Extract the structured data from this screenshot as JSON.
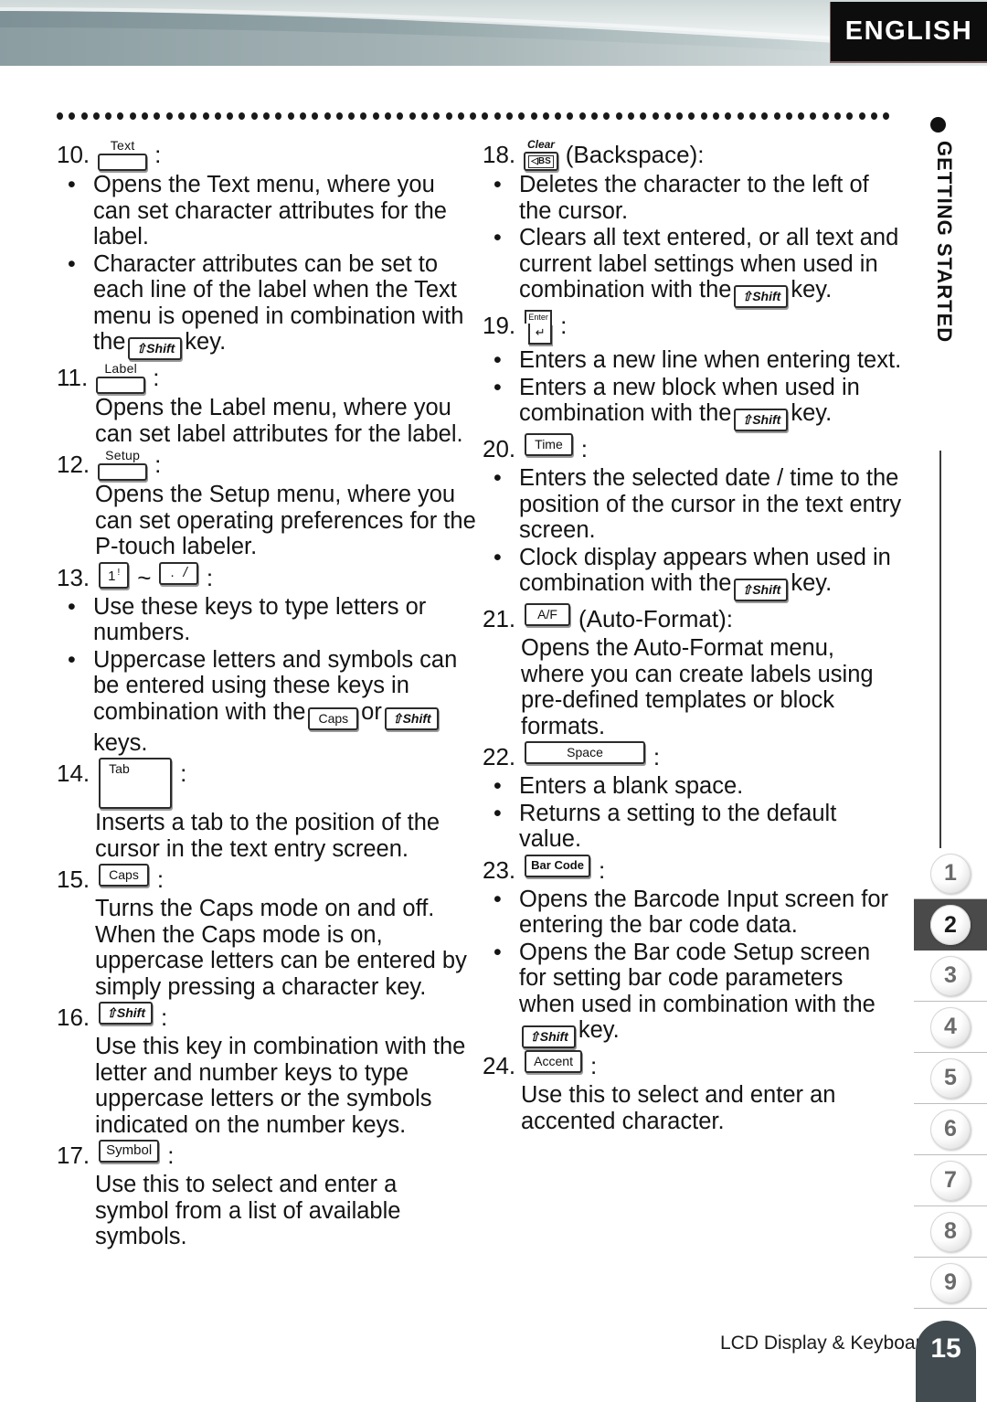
{
  "header": {
    "language_badge": "ENGLISH"
  },
  "side_rail": {
    "section_title": "GETTING STARTED",
    "tabs": [
      "1",
      "2",
      "3",
      "4",
      "5",
      "6",
      "7",
      "8",
      "9"
    ],
    "active_tab": "2"
  },
  "footer": {
    "caption": "LCD Display & Keyboard",
    "page_number": "15"
  },
  "keys": {
    "text": "Text",
    "label": "Label",
    "setup": "Setup",
    "shift": "⇧Shift",
    "caps": "Caps",
    "tab": "Tab",
    "symbol": "Symbol",
    "clear": "Clear",
    "bs": "BS",
    "enter_top": "Enter",
    "enter_arrow": "↵",
    "time": "Time",
    "af": "A/F",
    "space": "Space",
    "barcode": "Bar Code",
    "accent": "Accent",
    "num_one": "1",
    "num_one_sup": "!",
    "dot": ".",
    "slash": "/",
    "tilde": "~"
  },
  "left_column": [
    {
      "num": "10.",
      "key_type": "stack",
      "key_label": "Text",
      "suffix": "",
      "bullets": [
        "Opens the Text menu, where you can set character attributes for the label.",
        "Character attributes can be set to each line of the label when the Text menu is opened in combination with the ⇧Shift key."
      ],
      "paragraph": ""
    },
    {
      "num": "11.",
      "key_type": "stack",
      "key_label": "Label",
      "suffix": "",
      "bullets": [],
      "paragraph": "Opens the Label menu, where you can set label attributes for the label."
    },
    {
      "num": "12.",
      "key_type": "stack",
      "key_label": "Setup",
      "suffix": "",
      "bullets": [],
      "paragraph": "Opens the Setup menu, where you can set operating preferences for the P-touch labeler."
    },
    {
      "num": "13.",
      "key_type": "range",
      "key_label": "1 ! ~ . /",
      "suffix": "",
      "bullets": [
        "Use these keys to type letters or numbers.",
        "Uppercase letters and symbols can be entered using these keys in combination with the Caps or ⇧Shift keys."
      ],
      "paragraph": ""
    },
    {
      "num": "14.",
      "key_type": "cap",
      "key_label": "Tab",
      "suffix": "",
      "bullets": [],
      "paragraph": "Inserts a tab to the position of the cursor in the text entry screen."
    },
    {
      "num": "15.",
      "key_type": "cap",
      "key_label": "Caps",
      "suffix": "",
      "bullets": [],
      "paragraph": "Turns the Caps mode on and off. When the Caps mode is on, uppercase letters can be entered by simply pressing a character key."
    },
    {
      "num": "16.",
      "key_type": "cap",
      "key_label": "⇧Shift",
      "suffix": "",
      "bullets": [],
      "paragraph": "Use this key in combination with the letter and number keys to type uppercase letters or the symbols indicated on the number keys."
    },
    {
      "num": "17.",
      "key_type": "cap",
      "key_label": "Symbol",
      "suffix": "",
      "bullets": [],
      "paragraph": "Use this to select and enter a symbol from a list of available symbols."
    }
  ],
  "right_column": [
    {
      "num": "18.",
      "key_type": "clear",
      "key_label": "Clear BS",
      "suffix": "(Backspace)",
      "bullets": [
        "Deletes the character to the left of the cursor.",
        "Clears all text entered, or all text and current label settings when used in combination with the ⇧Shift key."
      ],
      "paragraph": ""
    },
    {
      "num": "19.",
      "key_type": "enter",
      "key_label": "Enter",
      "suffix": "",
      "bullets": [
        "Enters a new line when entering text.",
        "Enters a new block when used in combination with the ⇧Shift key."
      ],
      "paragraph": ""
    },
    {
      "num": "20.",
      "key_type": "cap",
      "key_label": "Time",
      "suffix": "",
      "bullets": [
        "Enters the selected date / time to the position of the cursor in the text entry screen.",
        "Clock display appears when used in combination with the ⇧Shift key."
      ],
      "paragraph": ""
    },
    {
      "num": "21.",
      "key_type": "cap",
      "key_label": "A/F",
      "suffix": "(Auto-Format)",
      "bullets": [],
      "paragraph": "Opens the Auto-Format menu, where you can create labels using pre-defined templates or block formats."
    },
    {
      "num": "22.",
      "key_type": "cap",
      "key_label": "Space",
      "suffix": "",
      "bullets": [
        "Enters a blank space.",
        "Returns a setting to the default value."
      ],
      "paragraph": ""
    },
    {
      "num": "23.",
      "key_type": "cap",
      "key_label": "Bar Code",
      "suffix": "",
      "bullets": [
        "Opens the Barcode Input screen for entering the bar code data.",
        "Opens the Bar code Setup screen for setting bar code parameters when used in combination with the ⇧Shift key."
      ],
      "paragraph": ""
    },
    {
      "num": "24.",
      "key_type": "cap",
      "key_label": "Accent",
      "suffix": "",
      "bullets": [],
      "paragraph": "Use this to select and enter an accented character."
    }
  ],
  "text_fragments": {
    "t10b1": "Opens the Text menu, where you can set character attributes for the label.",
    "t10b2a": "Character attributes can be set to each line of the label when the Text menu is opened in combination with the",
    "t10b2b": "key.",
    "t11p": "Opens the Label menu, where you can set label attributes for the label.",
    "t12p": "Opens the Setup menu, where you can set operating preferences for the P-touch labeler.",
    "t13b1": "Use these keys to type letters or numbers.",
    "t13b2a": "Uppercase letters and symbols can be entered using these keys in combination with the",
    "t13b2or": "or",
    "t13b2b": "keys.",
    "t14p": "Inserts a tab to the position of the cursor in the text entry screen.",
    "t15p": "Turns the Caps mode on and off. When the Caps mode is on, uppercase letters can be entered by simply pressing a character key.",
    "t16p": "Use this key in combination with the letter and number keys to type uppercase letters or the symbols indicated on the number keys.",
    "t17p": "Use this to select and enter a symbol from a list of available symbols.",
    "t18suffix": "(Backspace):",
    "t18b1": "Deletes the character to the left of the cursor.",
    "t18b2a": "Clears all text entered, or all text and current label settings when used in combination with the",
    "t18b2b": "key.",
    "t19b1": "Enters a new line when entering text.",
    "t19b2a": "Enters a new block when used in combination with the",
    "t19b2b": "key.",
    "t20b1": "Enters the selected date / time to the position of the cursor in the text entry screen.",
    "t20b2a": "Clock display appears when used in combination with the",
    "t20b2b": "key.",
    "t21suffix": "(Auto-Format):",
    "t21p": "Opens the Auto-Format menu, where you can create labels using pre-defined templates or block formats.",
    "t22b1": "Enters a blank space.",
    "t22b2": "Returns a setting to the default value.",
    "t23b1": "Opens the Barcode Input screen for entering the bar code data.",
    "t23b2a": "Opens the Bar code Setup screen for setting bar code parameters when used in combination with the",
    "t23b2b": "key.",
    "t24p": "Use this to select and enter an accented character.",
    "colon": ":",
    "bullet_char": "•",
    "nums": {
      "n10": "10.",
      "n11": "11.",
      "n12": "12.",
      "n13": "13.",
      "n14": "14.",
      "n15": "15.",
      "n16": "16.",
      "n17": "17.",
      "n18": "18.",
      "n19": "19.",
      "n20": "20.",
      "n21": "21.",
      "n22": "22.",
      "n23": "23.",
      "n24": "24."
    }
  },
  "colors": {
    "banner_gradient_dark": "#87999c",
    "banner_gradient_light": "#dfe6e6",
    "badge_bg": "#0d0d0d",
    "page_tab_bg": "#414b50",
    "active_tab_bg": "#4a4a4a"
  }
}
